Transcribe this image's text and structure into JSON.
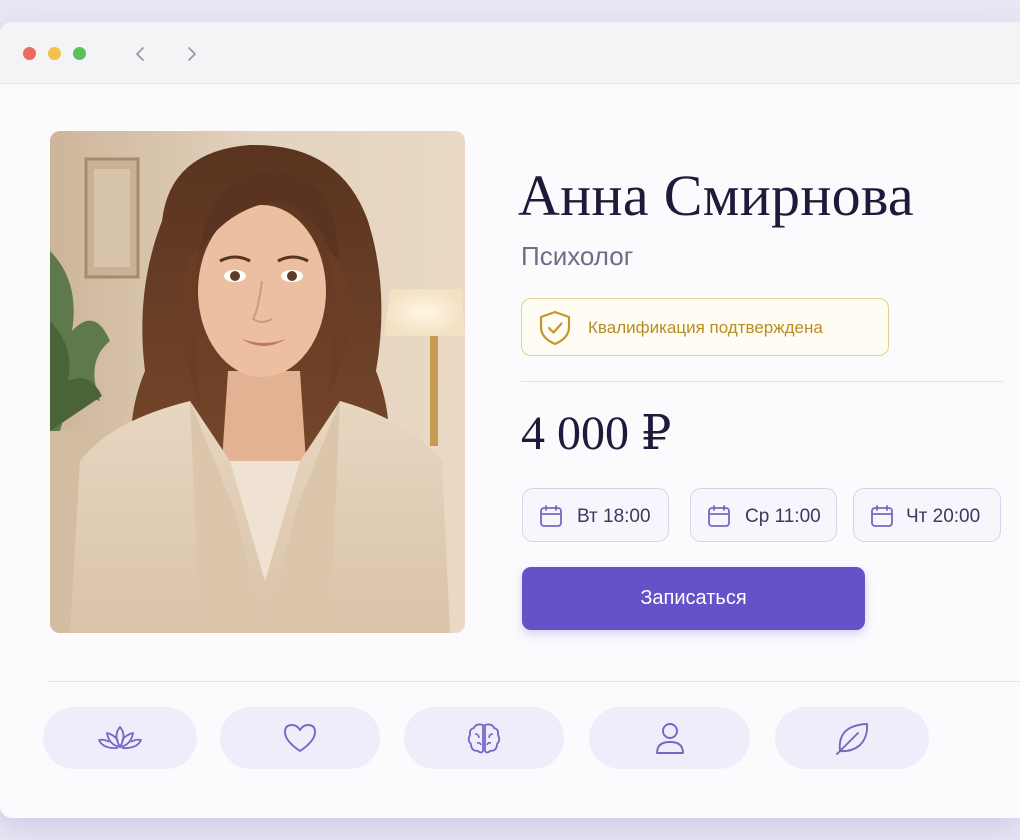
{
  "window": {
    "controls": [
      "close",
      "minimize",
      "maximize"
    ],
    "nav": {
      "back_icon": "chevron-left-icon",
      "forward_icon": "chevron-right-icon"
    }
  },
  "profile": {
    "photo": "portrait-photo",
    "name": "Анна Смирнова",
    "profession": "Психолог",
    "badge": {
      "icon": "shield-check-icon",
      "label": "Квалификация подтверждена"
    },
    "price": "4 000 ₽"
  },
  "slots": [
    {
      "icon": "calendar-icon",
      "label": "Вт 18:00"
    },
    {
      "icon": "calendar-icon",
      "label": "Ср 11:00"
    },
    {
      "icon": "calendar-icon",
      "label": "Чт 20:00"
    }
  ],
  "cta": {
    "label": "Записаться"
  },
  "categories": [
    {
      "icon": "lotus-icon"
    },
    {
      "icon": "heart-icon"
    },
    {
      "icon": "brain-icon"
    },
    {
      "icon": "person-icon"
    },
    {
      "icon": "leaf-icon"
    }
  ],
  "colors": {
    "accent": "#6352c8",
    "badge_gold": "#b88d24",
    "text_dark": "#1d1b3a",
    "icon_purple": "#7468c4"
  }
}
